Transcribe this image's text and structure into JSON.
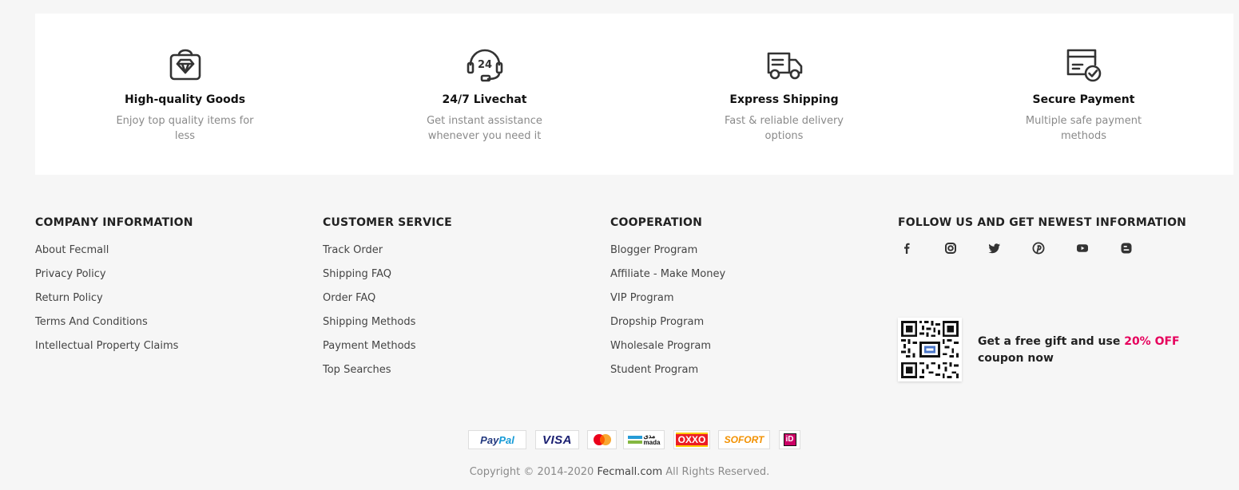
{
  "features": [
    {
      "icon": "shopping-bag-diamond-icon",
      "title": "High-quality Goods",
      "desc": "Enjoy top quality items for less"
    },
    {
      "icon": "headset-24-icon",
      "title": "24/7 Livechat",
      "desc": "Get instant assistance whenever you need it"
    },
    {
      "icon": "delivery-truck-icon",
      "title": "Express Shipping",
      "desc": "Fast & reliable delivery options"
    },
    {
      "icon": "secure-card-check-icon",
      "title": "Secure Payment",
      "desc": "Multiple safe payment methods"
    }
  ],
  "footer": {
    "company": {
      "title": "COMPANY INFORMATION",
      "links": [
        "About Fecmall",
        "Privacy Policy",
        "Return Policy",
        "Terms And Conditions",
        "Intellectual Property Claims"
      ]
    },
    "service": {
      "title": "CUSTOMER SERVICE",
      "links": [
        "Track Order",
        "Shipping FAQ",
        "Order FAQ",
        "Shipping Methods",
        "Payment Methods",
        "Top Searches"
      ]
    },
    "cooperation": {
      "title": "COOPERATION",
      "links": [
        "Blogger Program",
        "Affiliate - Make Money",
        "VIP Program",
        "Dropship Program",
        "Wholesale Program",
        "Student Program"
      ]
    },
    "follow": {
      "title": "FOLLOW US AND GET NEWEST INFORMATION",
      "socials": [
        "facebook-icon",
        "instagram-icon",
        "twitter-icon",
        "pinterest-icon",
        "youtube-icon",
        "blogger-icon"
      ]
    },
    "promo": {
      "text_before": "Get a free gift and use ",
      "highlight": "20% OFF",
      "text_after": " coupon now",
      "highlight_color": "#e6005c"
    },
    "payments": {
      "paypal": {
        "pay": "Pay",
        "pal": "Pal"
      },
      "visa": "VISA",
      "mastercard_icon": "mastercard-icon",
      "mada": {
        "arabic": "مدى",
        "latin": "mada"
      },
      "oxxo": "OXXO",
      "sofort": "SOFORT",
      "ideal": "iD"
    },
    "copyright": {
      "prefix": "Copyright © 2014-2020 ",
      "site": "Fecmall.com",
      "suffix": " All Rights Reserved."
    }
  },
  "colors": {
    "page_bg": "#f6f6f6",
    "card_bg": "#ffffff",
    "accent": "#e6005c"
  }
}
